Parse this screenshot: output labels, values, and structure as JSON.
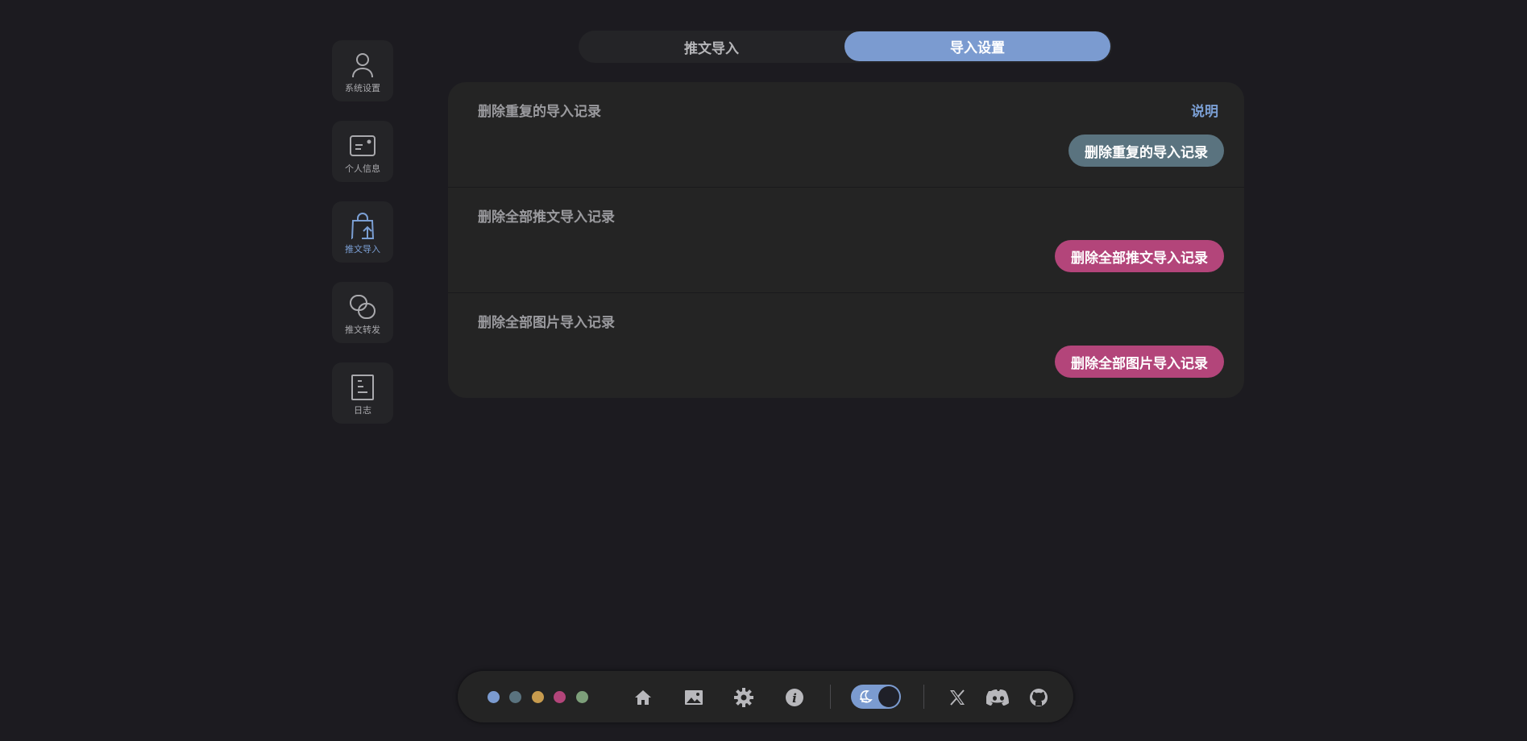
{
  "sidebar": {
    "items": [
      {
        "label": "系统设置",
        "icon": "user-icon"
      },
      {
        "label": "个人信息",
        "icon": "id-card-icon"
      },
      {
        "label": "推文导入",
        "icon": "import-bag-icon",
        "active": true
      },
      {
        "label": "推文转发",
        "icon": "link-icon"
      },
      {
        "label": "日志",
        "icon": "document-icon"
      }
    ]
  },
  "tabs": [
    {
      "label": "推文导入",
      "active": false
    },
    {
      "label": "导入设置",
      "active": true
    }
  ],
  "sections": [
    {
      "title": "删除重复的导入记录",
      "link": "说明",
      "button": "删除重复的导入记录",
      "button_color": "#5a737f"
    },
    {
      "title": "删除全部推文导入记录",
      "button": "删除全部推文导入记录",
      "button_color": "#b3457a"
    },
    {
      "title": "删除全部图片导入记录",
      "button": "删除全部图片导入记录",
      "button_color": "#b3457a"
    }
  ],
  "bottom_bar": {
    "theme_colors": [
      "#7b9bd0",
      "#5a737f",
      "#c79b4e",
      "#b3457a",
      "#7d9f7a"
    ],
    "nav_icons": [
      "home-icon",
      "image-icon",
      "gear-icon",
      "info-icon"
    ],
    "theme_toggle": {
      "state": "dark",
      "icon": "moon-icon"
    },
    "social_icons": [
      "x-icon",
      "discord-icon",
      "github-icon"
    ]
  },
  "colors": {
    "accent": "#7b9bd0",
    "danger": "#b3457a",
    "neutral_button": "#5a737f",
    "background": "#1c1b20",
    "panel": "#242424"
  }
}
